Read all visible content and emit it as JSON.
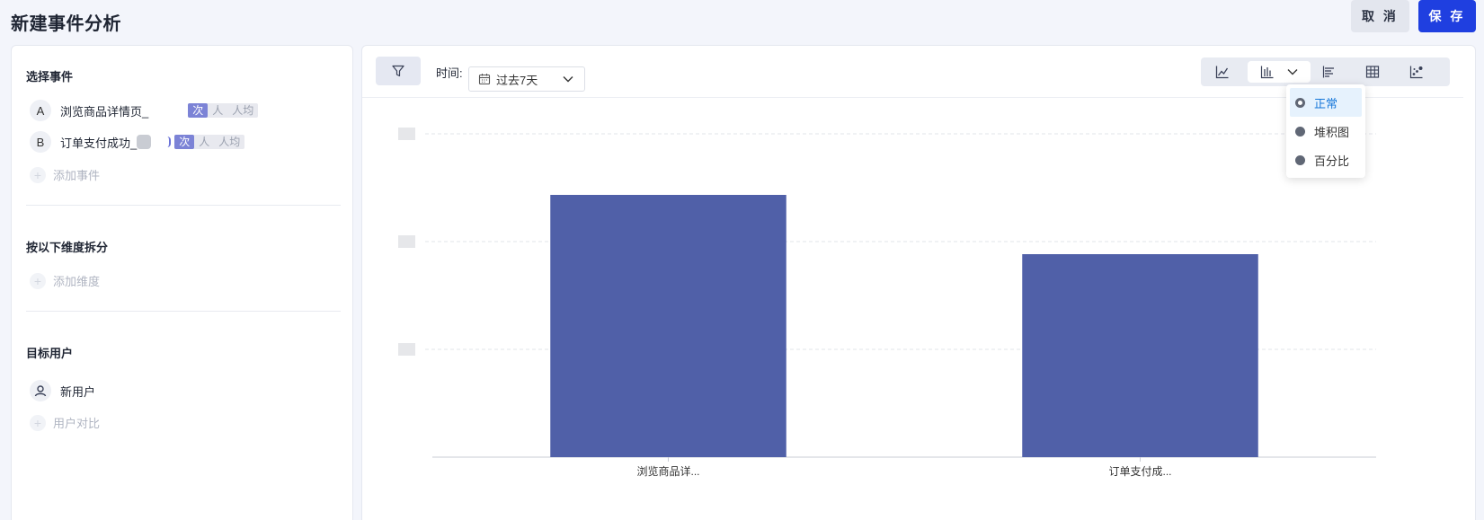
{
  "header": {
    "title": "新建事件分析",
    "cancel_label": "取 消",
    "save_label": "保 存"
  },
  "left_panel": {
    "events_title": "选择事件",
    "events": [
      {
        "letter": "A",
        "name": "浏览商品详情页_",
        "metrics": [
          "次",
          "人",
          "人均"
        ],
        "active_metric": "次"
      },
      {
        "letter": "B",
        "name": "订单支付成功_",
        "metrics": [
          "次",
          "人",
          "人均"
        ],
        "active_metric": "次"
      }
    ],
    "add_event_label": "添加事件",
    "dimension_title": "按以下维度拆分",
    "add_dimension_label": "添加维度",
    "target_title": "目标用户",
    "user_group": "新用户",
    "user_compare_label": "用户对比"
  },
  "right_panel": {
    "time_label": "时间:",
    "time_range": "过去7天",
    "toolbar_icons": [
      "line-chart-icon",
      "bar-chart-icon",
      "horizontal-bar-icon",
      "table-icon",
      "scatter-icon"
    ],
    "bar_mode_options": [
      "正常",
      "堆积图",
      "百分比"
    ],
    "selected_bar_mode": "正常"
  },
  "colors": {
    "bar": "#5060a8",
    "accent": "#1f3fe0",
    "selected_option": "#1677d9"
  },
  "chart_data": {
    "type": "bar",
    "categories": [
      "浏览商品详...",
      "订单支付成..."
    ],
    "values": [
      73,
      56.5
    ],
    "ylim": [
      0,
      90
    ],
    "yticks": [
      0,
      30,
      60,
      90
    ],
    "grid": true,
    "xlabel": "",
    "ylabel": "",
    "title": ""
  }
}
